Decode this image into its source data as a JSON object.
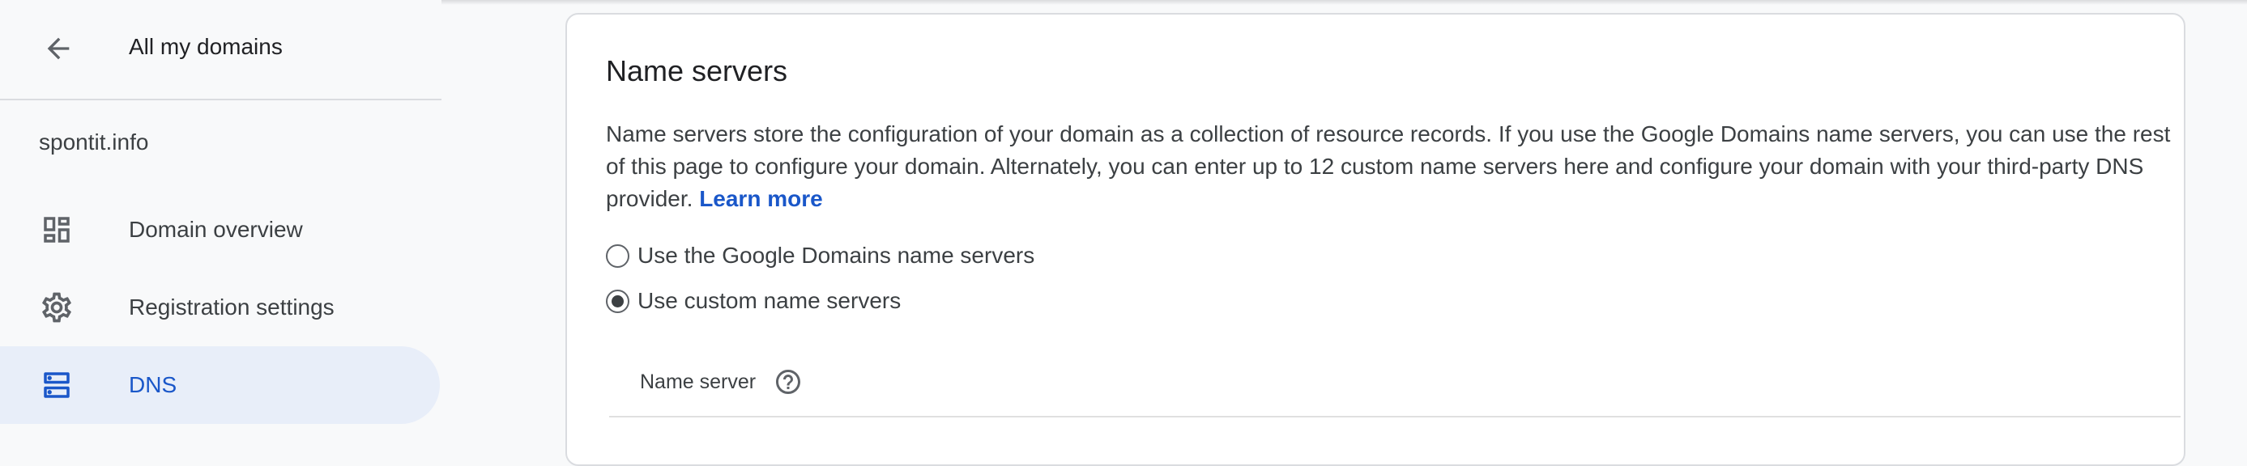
{
  "sidebar": {
    "back_label": "All my domains",
    "domain": "spontit.info",
    "items": [
      {
        "label": "Domain overview",
        "icon": "dashboard-icon",
        "active": false
      },
      {
        "label": "Registration settings",
        "icon": "gear-icon",
        "active": false
      },
      {
        "label": "DNS",
        "icon": "dns-icon",
        "active": true
      }
    ]
  },
  "main": {
    "title": "Name servers",
    "description": "Name servers store the configuration of your domain as a collection of resource records. If you use the Google Domains name servers, you can use the rest of this page to configure your domain. Alternately, you can enter up to 12 custom name servers here and configure your domain with your third-party DNS provider.",
    "learn_more": "Learn more",
    "options": [
      {
        "label": "Use the Google Domains name servers",
        "selected": false
      },
      {
        "label": "Use custom name servers",
        "selected": true
      }
    ],
    "table_header": "Name server"
  },
  "colors": {
    "accent": "#1a57c9",
    "active_bg": "#e8eef9",
    "text": "#3c4043",
    "divider": "#dadce0"
  }
}
